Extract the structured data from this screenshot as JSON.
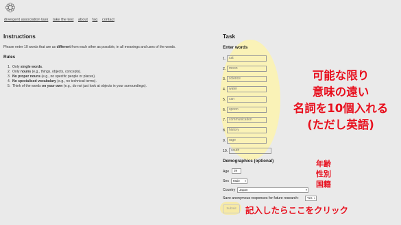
{
  "nav": {
    "items": [
      "divergent association task",
      "take the test",
      "about",
      "faq",
      "contact"
    ],
    "active_index": 1
  },
  "instructions": {
    "title": "Instructions",
    "intro_prefix": "Please enter 10 words that are as ",
    "intro_bold": "different",
    "intro_suffix": " from each other as possible, in all meanings and uses of the words.",
    "rules_title": "Rules",
    "rules": [
      {
        "pre": "Only ",
        "bold": "single words",
        "post": "."
      },
      {
        "pre": "Only ",
        "bold": "nouns",
        "post": " (e.g., things, objects, concepts)."
      },
      {
        "pre": "",
        "bold": "No proper nouns",
        "post": " (e.g., no specific people or places)."
      },
      {
        "pre": "",
        "bold": "No specialised vocabulary",
        "post": " (e.g., no technical terms)."
      },
      {
        "pre": "Think of the words ",
        "bold": "on your own",
        "post": " (e.g., do not just look at objects in your surroundings)."
      }
    ]
  },
  "task": {
    "title": "Task",
    "enter_words_label": "Enter words",
    "words": [
      "cat",
      "moon",
      "science",
      "water",
      "can",
      "spoon",
      "communication",
      "history",
      "rage",
      "south"
    ]
  },
  "demographics": {
    "title": "Demographics (optional)",
    "age_label": "Age",
    "age_value": "39",
    "sex_label": "Sex",
    "sex_value": "Male",
    "country_label": "Country",
    "country_value": "Japan",
    "save_label": "Save anonymous responses for future research",
    "save_value": "Yes",
    "submit_label": "Submit"
  },
  "annotations": {
    "main": [
      "可能な限り",
      "意味の遠い",
      "名詞を10個入れる",
      "(ただし英語)"
    ],
    "demographics": [
      "年齢",
      "性別",
      "国籍"
    ],
    "submit": "記入したらここをクリック",
    "color": "#e8101e",
    "highlight_color": "#fbf2b4"
  }
}
